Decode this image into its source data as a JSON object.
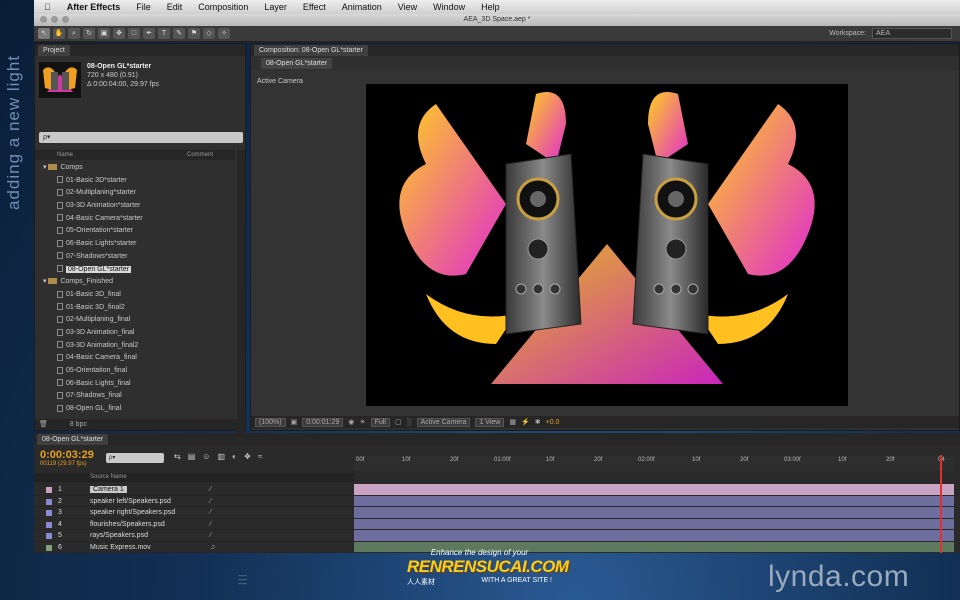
{
  "side_caption": "adding a new light",
  "menubar": {
    "app": "After Effects",
    "items": [
      "File",
      "Edit",
      "Composition",
      "Layer",
      "Effect",
      "Animation",
      "View",
      "Window",
      "Help"
    ]
  },
  "window_title": "AEA_3D Space.aep *",
  "workspace": {
    "label": "Workspace:",
    "value": "AEA"
  },
  "project": {
    "tab": "Project",
    "comp_name": "08-Open GL*starter",
    "dims": "720 x 480 (0.91)",
    "duration": "Δ 0:00:04:00, 29.97 fps",
    "search_placeholder": "ρ▾",
    "col_name": "Name",
    "col_comment": "Comment",
    "folders": [
      {
        "name": "Comps",
        "items": [
          "01-Basic 3D*starter",
          "02-Multiplaning*starter",
          "03-3D Animation*starter",
          "04-Basic Camera*starter",
          "05-Orientation*starter",
          "06-Basic Lights*starter",
          "07-Shadows*starter",
          "08-Open GL*starter"
        ]
      },
      {
        "name": "Comps_Finished",
        "items": [
          "01-Basic 3D_final",
          "01-Basic 3D_final2",
          "02-Multiplaning_final",
          "03-3D Animation_final",
          "03-3D Animation_final2",
          "04-Basic Camera_final",
          "05-Orientation_final",
          "06-Basic Lights_final",
          "07-Shadows_final",
          "08-Open GL_final"
        ]
      }
    ],
    "selected_item": "08-Open GL*starter",
    "bpc": "8 bpc"
  },
  "composition": {
    "tab": "Composition: 08-Open GL*starter",
    "subtab": "08-Open GL*starter",
    "view_label": "Active Camera",
    "zoom": "(100%)",
    "time": "0:00:01:29",
    "resolution": "Full",
    "camera": "Active Camera",
    "views": "1 View",
    "exposure": "+0.0"
  },
  "timeline": {
    "tab": "08-Open GL*starter",
    "timecode": "0:00:03:29",
    "frames": "00119 (29.97 fps)",
    "search_placeholder": "ρ▾",
    "source_name_header": "Source Name",
    "ruler_labels": [
      "00f",
      "10f",
      "20f",
      "01:00f",
      "10f",
      "20f",
      "02:00f",
      "10f",
      "20f",
      "03:00f",
      "10f",
      "20f",
      "04"
    ],
    "layers": [
      {
        "num": "1",
        "name": "Camera 1",
        "color": "#c9a0c0"
      },
      {
        "num": "2",
        "name": "speaker left/Speakers.psd",
        "color": "#8a8ad0"
      },
      {
        "num": "3",
        "name": "speaker right/Speakers.psd",
        "color": "#8a8ad0"
      },
      {
        "num": "4",
        "name": "flourishes/Speakers.psd",
        "color": "#8a8ad0"
      },
      {
        "num": "5",
        "name": "rays/Speakers.psd",
        "color": "#8a8ad0"
      },
      {
        "num": "6",
        "name": "Music Express.mov",
        "color": "#7fa07f"
      }
    ]
  },
  "watermark": {
    "top": "Enhance the design of your",
    "main": "RENRENSUCAI.COM",
    "left": "人人素材",
    "right": "WITH A GREAT SITE !"
  },
  "brand": "lynda.com"
}
